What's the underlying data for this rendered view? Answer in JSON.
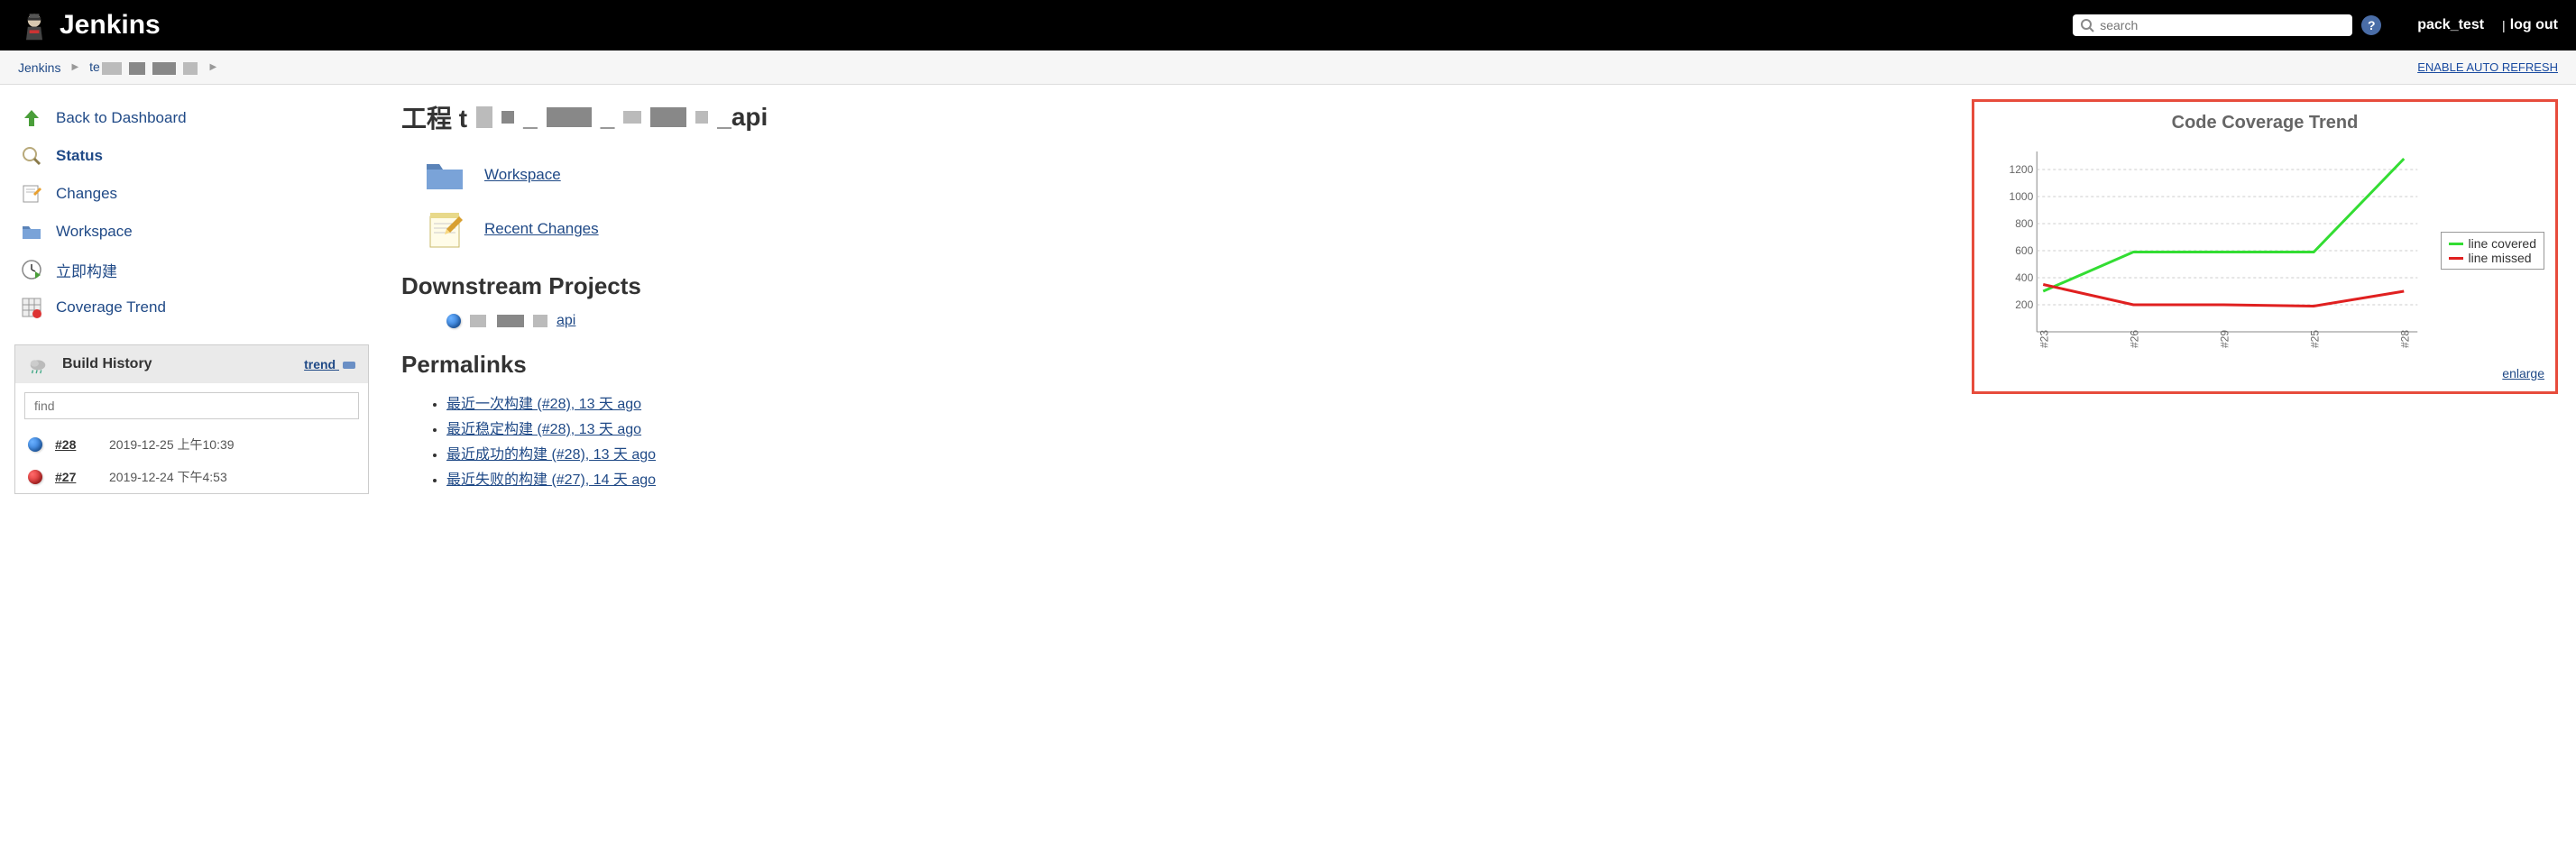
{
  "header": {
    "title": "Jenkins",
    "search_placeholder": "search",
    "user": "pack_test",
    "logout": "log out"
  },
  "breadcrumb": {
    "items": [
      "Jenkins",
      "te"
    ],
    "auto_refresh": "ENABLE AUTO REFRESH"
  },
  "sidebar": {
    "items": [
      {
        "label": "Back to Dashboard",
        "icon": "arrow-up"
      },
      {
        "label": "Status",
        "icon": "magnifier",
        "active": true
      },
      {
        "label": "Changes",
        "icon": "edit-page"
      },
      {
        "label": "Workspace",
        "icon": "folder"
      },
      {
        "label": "立即构建",
        "icon": "clock-play"
      },
      {
        "label": "Coverage Trend",
        "icon": "grid-red"
      }
    ],
    "build_history": {
      "title": "Build History",
      "trend_link": "trend",
      "filter_placeholder": "find",
      "builds": [
        {
          "num": "#28",
          "time": "2019-12-25 上午10:39",
          "status": "blue"
        },
        {
          "num": "#27",
          "time": "2019-12-24 下午4:53",
          "status": "red"
        }
      ]
    }
  },
  "main": {
    "project_prefix": "工程 t",
    "project_suffix": "_api",
    "workspace_link": "Workspace",
    "recent_changes_link": "Recent Changes",
    "downstream_title": "Downstream Projects",
    "downstream_suffix": "api",
    "permalinks_title": "Permalinks",
    "permalinks": [
      "最近一次构建 (#28), 13 天 ago",
      "最近稳定构建 (#28), 13 天 ago",
      "最近成功的构建 (#28), 13 天 ago",
      "最近失败的构建 (#27), 14 天 ago"
    ]
  },
  "chart": {
    "title": "Code Coverage Trend",
    "legend_covered": "line covered",
    "legend_missed": "line missed",
    "enlarge": "enlarge"
  },
  "chart_data": {
    "type": "line",
    "title": "Code Coverage Trend",
    "xlabel": "",
    "ylabel": "",
    "ylim": [
      0,
      1300
    ],
    "y_ticks": [
      200,
      400,
      600,
      800,
      1000,
      1200
    ],
    "categories": [
      "#23",
      "#26",
      "#29",
      "#25",
      "#28"
    ],
    "series": [
      {
        "name": "line covered",
        "color": "#33dd33",
        "values": [
          300,
          590,
          590,
          590,
          1280
        ]
      },
      {
        "name": "line missed",
        "color": "#e02020",
        "values": [
          350,
          200,
          200,
          190,
          300
        ]
      }
    ]
  }
}
